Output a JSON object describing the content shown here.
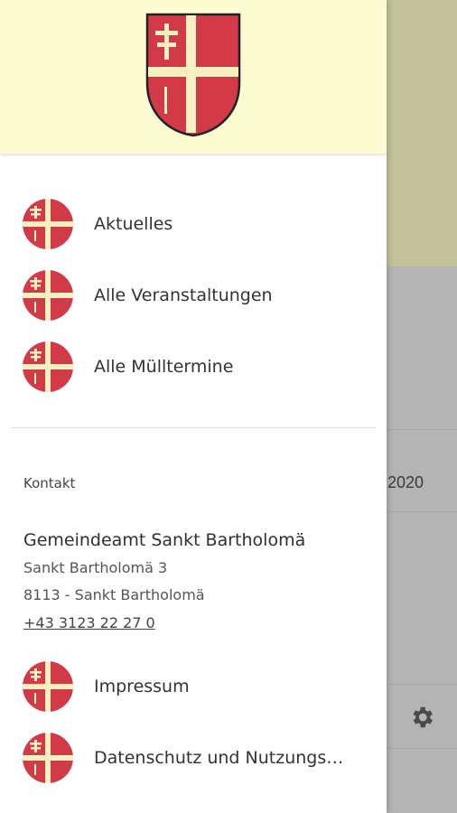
{
  "background": {
    "date_fragment": ".2020",
    "settings_icon": "gear-icon"
  },
  "drawer": {
    "header": {
      "logo": "coat-of-arms-logo"
    },
    "nav_items": [
      {
        "label": "Aktuelles",
        "icon": "coat-of-arms-icon"
      },
      {
        "label": "Alle Veranstaltungen",
        "icon": "coat-of-arms-icon"
      },
      {
        "label": "Alle Mülltermine",
        "icon": "coat-of-arms-icon"
      }
    ],
    "contact": {
      "section_label": "Kontakt",
      "org_name": "Gemeindeamt Sankt Bartholomä",
      "street": "Sankt Bartholomä 3",
      "city": "8113 - Sankt Bartholomä",
      "phone": "+43 3123 22 27 0"
    },
    "footer_items": [
      {
        "label": "Impressum",
        "icon": "coat-of-arms-icon"
      },
      {
        "label": "Datenschutz und Nutzungs…",
        "icon": "coat-of-arms-icon"
      }
    ]
  },
  "colors": {
    "header_bg": "#fdfbd1",
    "crest_red": "#d23a48",
    "crest_cross": "#f6efbf"
  }
}
